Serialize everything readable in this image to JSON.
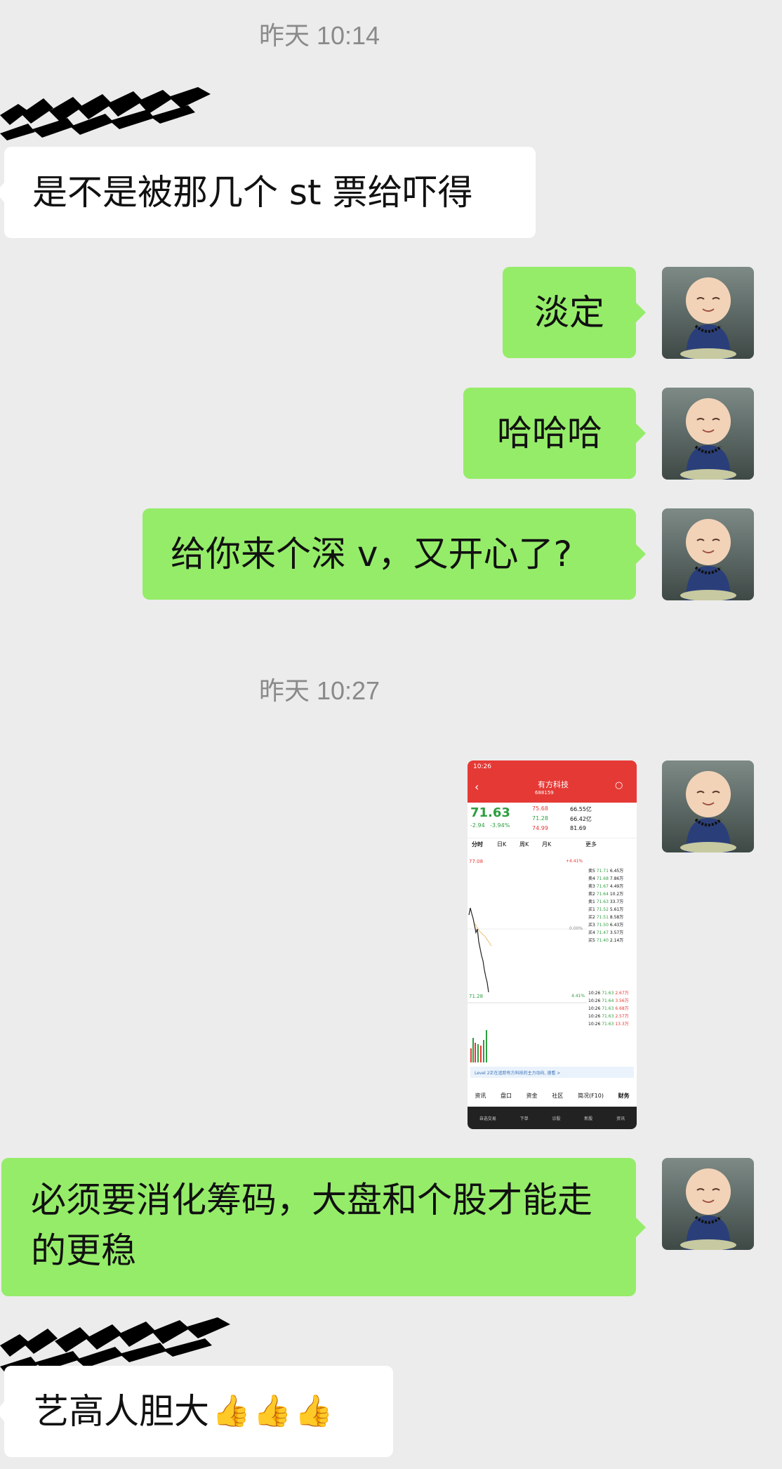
{
  "chat": {
    "timestamp_1": "昨天 10:14",
    "timestamp_2": "昨天 10:27",
    "messages": [
      {
        "side": "in",
        "text": "是不是被那几个 st 票给吓得"
      },
      {
        "side": "out",
        "text": "淡定"
      },
      {
        "side": "out",
        "text": "哈哈哈"
      },
      {
        "side": "out",
        "text": "给你来个深 v，又开心了?"
      },
      {
        "side": "out",
        "type": "image",
        "alt": "stock-screenshot"
      },
      {
        "side": "out",
        "text": "必须要消化筹码，大盘和个股才能走的更稳"
      },
      {
        "side": "in",
        "text": "艺高人胆大",
        "emoji": [
          "👍",
          "👍",
          "👍"
        ]
      }
    ]
  },
  "stock_screenshot": {
    "status_time": "10:26",
    "stock_name": "有方科技",
    "stock_code": "688159",
    "price": "71.63",
    "change": "-2.94",
    "change_pct": "-3.94%",
    "high": "75.68",
    "low": "71.28",
    "open": "74.99",
    "market_cap": "66.55亿",
    "float_cap": "66.42亿",
    "pe_ratio": "81.69",
    "tab_intraday": "分时",
    "tab_5day": "日K",
    "tab_week": "周K",
    "tab_month": "月K",
    "tab_more": "更多",
    "chart_high": "77.08",
    "chart_low": "71.28",
    "chart_mid_pct": "0.00%",
    "chart_low_pct": "4.41%",
    "chart_high_pct": "+4.41%",
    "order_book": [
      {
        "label": "卖5",
        "price": "71.71",
        "vol": "6.45万"
      },
      {
        "label": "卖4",
        "price": "71.68",
        "vol": "7.86万"
      },
      {
        "label": "卖3",
        "price": "71.67",
        "vol": "4.49万"
      },
      {
        "label": "卖2",
        "price": "71.64",
        "vol": "10.2万"
      },
      {
        "label": "卖1",
        "price": "71.63",
        "vol": "33.7万"
      },
      {
        "label": "买1",
        "price": "71.52",
        "vol": "5.61万"
      },
      {
        "label": "买2",
        "price": "71.51",
        "vol": "8.58万"
      },
      {
        "label": "买3",
        "price": "71.50",
        "vol": "6.43万"
      },
      {
        "label": "买4",
        "price": "71.47",
        "vol": "3.57万"
      },
      {
        "label": "买5",
        "price": "71.40",
        "vol": "2.14万"
      }
    ],
    "trades": [
      {
        "time": "10:26",
        "price": "71.63",
        "vol": "2.67万"
      },
      {
        "time": "10:26",
        "price": "71.64",
        "vol": "3.56万"
      },
      {
        "time": "10:26",
        "price": "71.63",
        "vol": "6.68万"
      },
      {
        "time": "10:26",
        "price": "71.63",
        "vol": "2.57万"
      },
      {
        "time": "10:26",
        "price": "71.63",
        "vol": "13.3万"
      }
    ],
    "banner": "Level 2正在追踪有方科技的主力动向, 速看 >",
    "subtabs": [
      "资讯",
      "盘口",
      "资金",
      "社区",
      "简况(F10)",
      "财务"
    ],
    "bottom_tabs": [
      "自选交易",
      "下单",
      "诊股",
      "新股",
      "资讯"
    ]
  },
  "colors": {
    "background": "#ececec",
    "bubble_out": "#95ec69",
    "bubble_in": "#ffffff",
    "timestamp": "#8a8a8a",
    "stock_red": "#e53935",
    "stock_green": "#2e9e3f"
  }
}
